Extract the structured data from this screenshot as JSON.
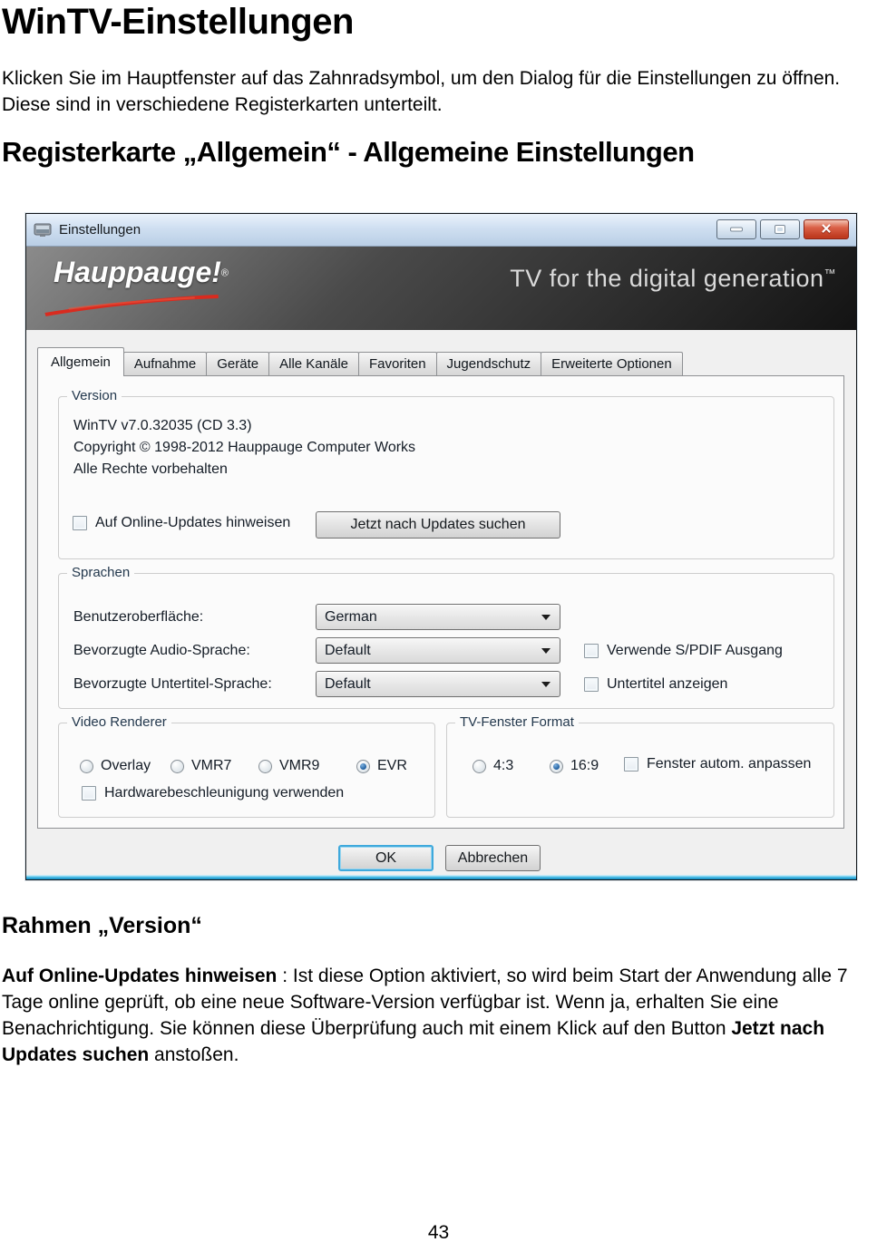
{
  "page": {
    "title": "WinTV-Einstellungen",
    "intro": "Klicken Sie im Hauptfenster auf das Zahnradsymbol, um den Dialog für die Einstellungen zu öffnen. Diese sind in verschiedene Registerkarten unterteilt.",
    "section_heading": "Registerkarte „Allgemein“ - Allgemeine Einstellungen",
    "page_number": "43"
  },
  "dialog": {
    "title": "Einstellungen",
    "brand": {
      "logo_text": "Hauppauge!",
      "logo_mark": "®",
      "tagline": "TV for the digital generation",
      "tagline_tm": "™"
    },
    "tabs": [
      {
        "label": "Allgemein",
        "active": true
      },
      {
        "label": "Aufnahme",
        "active": false
      },
      {
        "label": "Geräte",
        "active": false
      },
      {
        "label": "Alle Kanäle",
        "active": false
      },
      {
        "label": "Favoriten",
        "active": false
      },
      {
        "label": "Jugendschutz",
        "active": false
      },
      {
        "label": "Erweiterte Optionen",
        "active": false
      }
    ],
    "version_group": {
      "title": "Version",
      "lines": [
        "WinTV v7.0.32035 (CD 3.3)",
        "Copyright © 1998-2012  Hauppauge Computer Works",
        "Alle Rechte vorbehalten"
      ],
      "update_checkbox": {
        "label": "Auf Online-Updates hinweisen",
        "checked": false
      },
      "update_button": "Jetzt nach Updates suchen"
    },
    "languages_group": {
      "title": "Sprachen",
      "rows": [
        {
          "label": "Benutzeroberfläche:",
          "value": "German"
        },
        {
          "label": "Bevorzugte Audio-Sprache:",
          "value": "Default",
          "checkbox": {
            "label": "Verwende S/PDIF Ausgang",
            "checked": false
          }
        },
        {
          "label": "Bevorzugte Untertitel-Sprache:",
          "value": "Default",
          "checkbox": {
            "label": "Untertitel anzeigen",
            "checked": false
          }
        }
      ]
    },
    "video_renderer_group": {
      "title": "Video Renderer",
      "radios": [
        {
          "label": "Overlay",
          "selected": false
        },
        {
          "label": "VMR7",
          "selected": false
        },
        {
          "label": "VMR9",
          "selected": false
        },
        {
          "label": "EVR",
          "selected": true
        }
      ],
      "hw_checkbox": {
        "label": "Hardwarebeschleunigung verwenden",
        "checked": false
      }
    },
    "tv_format_group": {
      "title": "TV-Fenster Format",
      "radios": [
        {
          "label": "4:3",
          "selected": false
        },
        {
          "label": "16:9",
          "selected": true
        }
      ],
      "auto_checkbox": {
        "label": "Fenster autom. anpassen",
        "checked": false
      }
    },
    "ok_button": "OK",
    "cancel_button": "Abbrechen"
  },
  "notes": {
    "heading": "Rahmen „Version“",
    "bold1": "Auf Online-Updates hinweisen",
    "text1": " : Ist diese Option aktiviert, so wird beim Start der Anwendung alle 7 Tage online geprüft, ob eine neue Software-Version verfügbar ist. Wenn ja, erhalten Sie eine Benachrichtigung. Sie können diese Überprüfung auch mit einem Klick auf den Button ",
    "bold2": "Jetzt nach Updates suchen",
    "text2": " anstoßen."
  },
  "colors": {
    "close_button_red": "#c03a20",
    "titlebar_blue": "#cfdff1",
    "banner_dark": "#2b2b2b",
    "logo_red": "#d92b1f",
    "radio_selected_blue": "#1e5d9e",
    "frame_cyan": "#41b9e6"
  }
}
